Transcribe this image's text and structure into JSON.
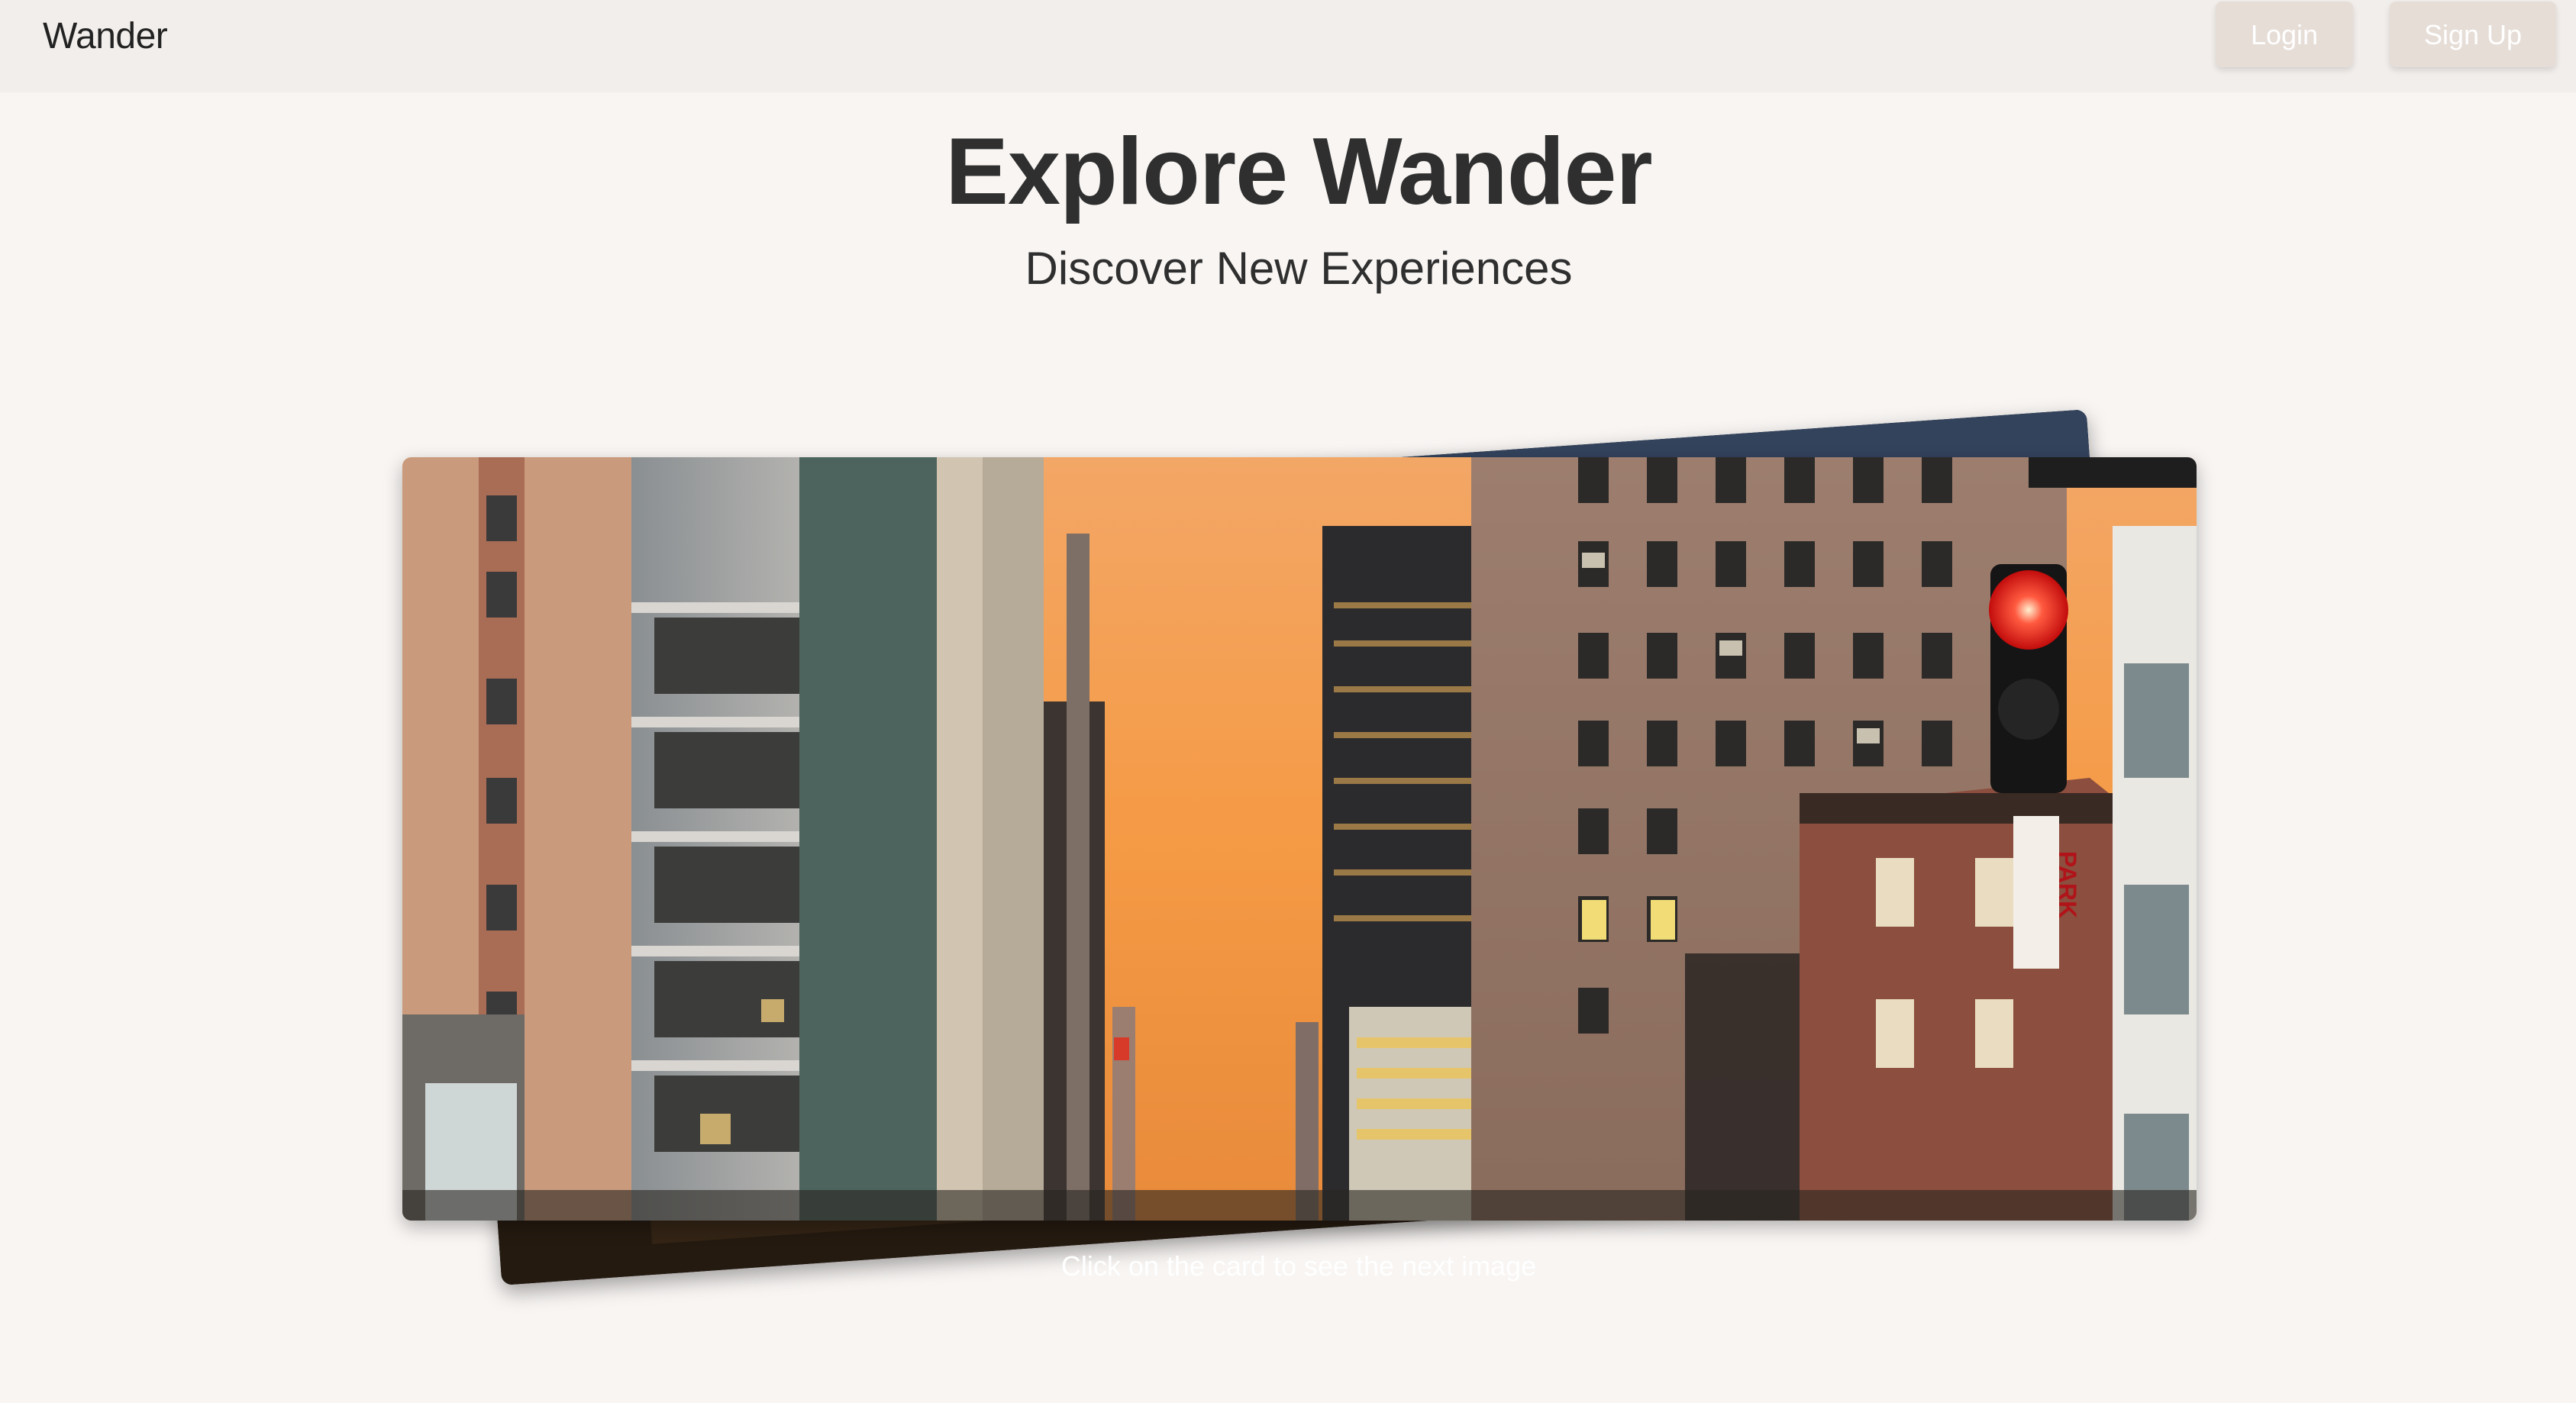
{
  "header": {
    "brand": "Wander",
    "login_label": "Login",
    "signup_label": "Sign Up"
  },
  "hero": {
    "title": "Explore Wander",
    "subtitle": "Discover New Experiences"
  },
  "gallery": {
    "hint": "Click on the card to see the next image",
    "current_image_description_icon": "city-street-photo",
    "street_sign_text": "PARK"
  },
  "colors": {
    "background": "#f8f5f3",
    "topbar": "#f2eeeb",
    "button": "#e6ddd7",
    "text_dark": "#2f2f2f"
  }
}
